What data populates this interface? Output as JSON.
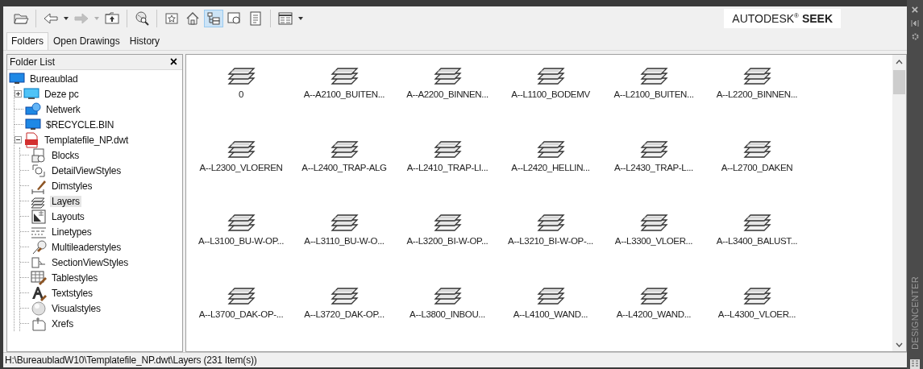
{
  "toolbar": [
    [
      {
        "kind": "open",
        "selected": false,
        "disabled": false
      }
    ],
    [
      {
        "kind": "back",
        "selected": false,
        "disabled": false
      },
      {
        "kind": "back-menu",
        "selected": false,
        "disabled": false
      },
      {
        "kind": "forward",
        "selected": false,
        "disabled": true
      },
      {
        "kind": "forward-menu",
        "selected": false,
        "disabled": true
      },
      {
        "kind": "up",
        "selected": false,
        "disabled": false
      }
    ],
    [
      {
        "kind": "search",
        "selected": false,
        "disabled": false
      }
    ],
    [
      {
        "kind": "favorites",
        "selected": false,
        "disabled": false
      },
      {
        "kind": "home",
        "selected": false,
        "disabled": false
      },
      {
        "kind": "tree-view",
        "selected": true,
        "disabled": false
      },
      {
        "kind": "preview",
        "selected": false,
        "disabled": false
      },
      {
        "kind": "description",
        "selected": false,
        "disabled": false
      }
    ],
    [
      {
        "kind": "views",
        "selected": false,
        "disabled": false
      },
      {
        "kind": "views-menu",
        "selected": false,
        "disabled": false
      }
    ]
  ],
  "brand": "AUTODESK$^{®}$ **SEEK**",
  "tabs": [
    {
      "label": "Folders",
      "selected": true
    },
    {
      "label": "Open Drawings",
      "selected": false
    },
    {
      "label": "History",
      "selected": false
    }
  ],
  "folder_list": {
    "title": "Folder List",
    "close": "×",
    "tree": [
      {
        "label": "Bureaublad",
        "kind": "desktop",
        "selected": false,
        "children": [
          {
            "label": "Deze pc",
            "kind": "pc",
            "selected": false,
            "expanded": false
          },
          {
            "label": "Netwerk",
            "kind": "network",
            "selected": false
          },
          {
            "label": "$RECYCLE.BIN",
            "kind": "desktop",
            "selected": false
          },
          {
            "label": "Templatefile_NP.dwt",
            "kind": "dwt",
            "selected": false,
            "expanded": true,
            "children": [
              {
                "label": "Blocks",
                "kind": "blocks",
                "selected": false
              },
              {
                "label": "DetailViewStyles",
                "kind": "detail",
                "selected": false
              },
              {
                "label": "Dimstyles",
                "kind": "dim",
                "selected": false
              },
              {
                "label": "Layers",
                "kind": "layers",
                "selected": true
              },
              {
                "label": "Layouts",
                "kind": "layouts",
                "selected": false
              },
              {
                "label": "Linetypes",
                "kind": "linetypes",
                "selected": false
              },
              {
                "label": "Multileaderstyles",
                "kind": "mleader",
                "selected": false
              },
              {
                "label": "SectionViewStyles",
                "kind": "section",
                "selected": false
              },
              {
                "label": "Tablestyles",
                "kind": "table",
                "selected": false
              },
              {
                "label": "Textstyles",
                "kind": "text",
                "selected": false
              },
              {
                "label": "Visualstyles",
                "kind": "visual",
                "selected": false
              },
              {
                "label": "Xrefs",
                "kind": "xref",
                "selected": false
              }
            ]
          }
        ]
      }
    ]
  },
  "items": [
    {
      "label": "0"
    },
    {
      "label": "A--A2100_BUITEN..."
    },
    {
      "label": "A--A2200_BINNEN..."
    },
    {
      "label": "A--L1100_BODEMV"
    },
    {
      "label": "A--L2100_BUITEN..."
    },
    {
      "label": "A--L2200_BINNEN..."
    },
    {
      "label": "A--L2300_VLOEREN"
    },
    {
      "label": "A--L2400_TRAP-ALG"
    },
    {
      "label": "A--L2410_TRAP-LI..."
    },
    {
      "label": "A--L2420_HELLIN..."
    },
    {
      "label": "A--L2430_TRAP-L..."
    },
    {
      "label": "A--L2700_DAKEN"
    },
    {
      "label": "A--L3100_BU-W-OP..."
    },
    {
      "label": "A--L3110_BU-W-O..."
    },
    {
      "label": "A--L3200_BI-W-OP..."
    },
    {
      "label": "A--L3210_BI-W-OP-..."
    },
    {
      "label": "A--L3300_VLOER..."
    },
    {
      "label": "A--L3400_BALUST..."
    },
    {
      "label": "A--L3700_DAK-OP-..."
    },
    {
      "label": "A--L3720_DAK-OP..."
    },
    {
      "label": "A--L3800_INBOU..."
    },
    {
      "label": "A--L4100_WAND..."
    },
    {
      "label": "A--L4200_WAND..."
    },
    {
      "label": "A--L4300_VLOER..."
    }
  ],
  "status_bar": "H:\\BureaubladW10\\Templatefile_NP.dwt\\Layers (231 Item(s))",
  "side_strip": {
    "close": "×",
    "title": "DESIGNCENTER"
  }
}
